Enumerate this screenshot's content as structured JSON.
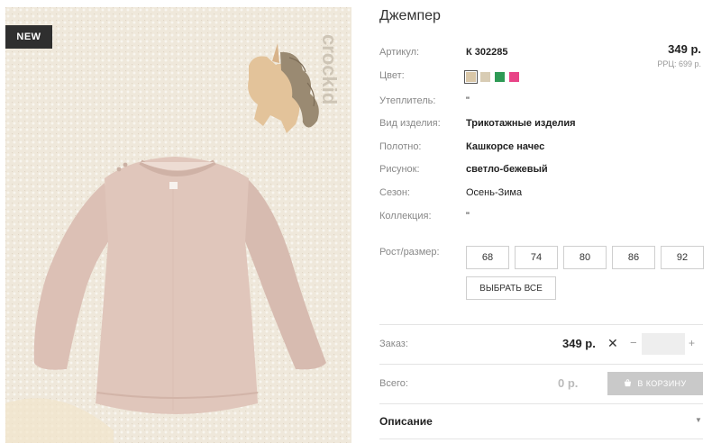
{
  "product": {
    "badge": "NEW",
    "title": "Джемпер",
    "price": "349 р.",
    "rrp": "РРЦ: 699 р."
  },
  "attributes": [
    {
      "label": "Артикул:",
      "value": "К 302285",
      "bold": true
    },
    {
      "label": "Цвет:",
      "value": "",
      "bold": false
    },
    {
      "label": "Утеплитель:",
      "value": "\"",
      "bold": false
    },
    {
      "label": "Вид изделия:",
      "value": "Трикотажные изделия",
      "bold": true
    },
    {
      "label": "Полотно:",
      "value": "Кашкорсе начес",
      "bold": true
    },
    {
      "label": "Рисунок:",
      "value": "светло-бежевый",
      "bold": true
    },
    {
      "label": "Сезон:",
      "value": "Осень-Зима",
      "bold": false
    },
    {
      "label": "Коллекция:",
      "value": "\"",
      "bold": false
    }
  ],
  "colors": [
    "#d9c7a8",
    "#d8ccb4",
    "#2e9a55",
    "#e84487"
  ],
  "sizes": {
    "label": "Рост/размер:",
    "options": [
      "68",
      "74",
      "80",
      "86",
      "92"
    ],
    "select_all": "ВЫБРАТЬ ВСЕ"
  },
  "order": {
    "label": "Заказ:",
    "price": "349 р.",
    "times": "✕",
    "minus": "−",
    "plus": "+",
    "quantity": ""
  },
  "total": {
    "label": "Всего:",
    "value": "0 р.",
    "cart_button": "В КОРЗИНУ"
  },
  "description": {
    "label": "Описание",
    "caret": "▼"
  },
  "watermark": "crockid"
}
